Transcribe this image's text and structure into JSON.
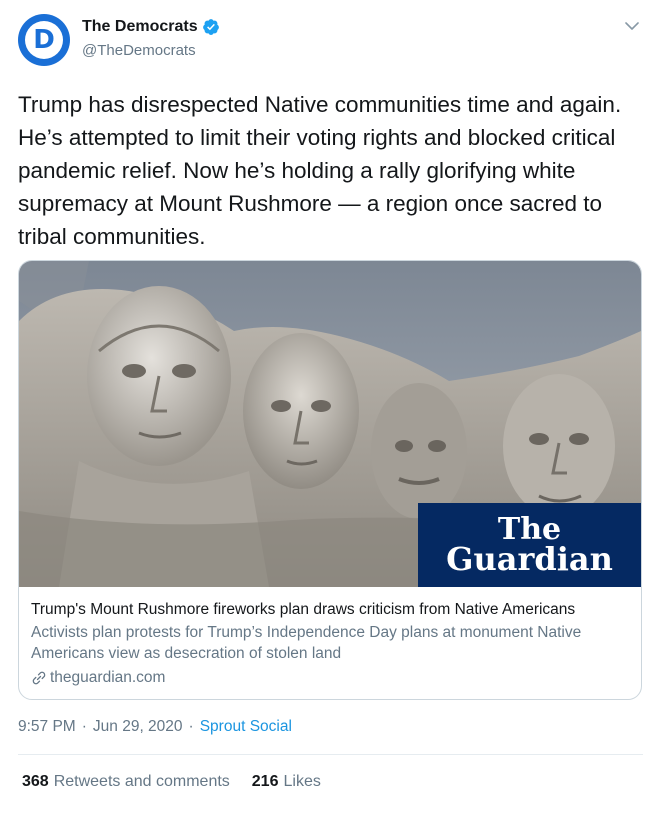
{
  "author": {
    "display_name": "The Democrats",
    "handle": "@TheDemocrats",
    "avatar_letter": "D",
    "verified_icon": "verified-badge-icon"
  },
  "header": {
    "menu_icon": "chevron-down-icon"
  },
  "tweet": {
    "text": "Trump has disrespected Native communities time and again. He’s attempted to limit their voting rights and blocked critical pandemic relief. Now he’s holding a rally glorifying white supremacy at Mount Rushmore — a region once sacred to tribal communities."
  },
  "card": {
    "badge_line1": "The",
    "badge_line2": "Guardian",
    "title": "Trump's Mount Rushmore fireworks plan draws criticism from Native Americans",
    "description": "Activists plan protests for Trump’s Independence Day plans at monument Native Americans view as desecration of stolen land",
    "domain": "theguardian.com",
    "link_icon": "link-icon"
  },
  "meta": {
    "time": "9:57 PM",
    "date": "Jun 29, 2020",
    "separator": "·",
    "source": "Sprout Social"
  },
  "stats": {
    "retweets_count": "368",
    "retweets_label": "Retweets and comments",
    "likes_count": "216",
    "likes_label": "Likes"
  },
  "colors": {
    "brand_blue": "#1a6fd6",
    "link_blue": "#1b95e0",
    "secondary_text": "#657786",
    "guardian_navy": "#052962"
  }
}
